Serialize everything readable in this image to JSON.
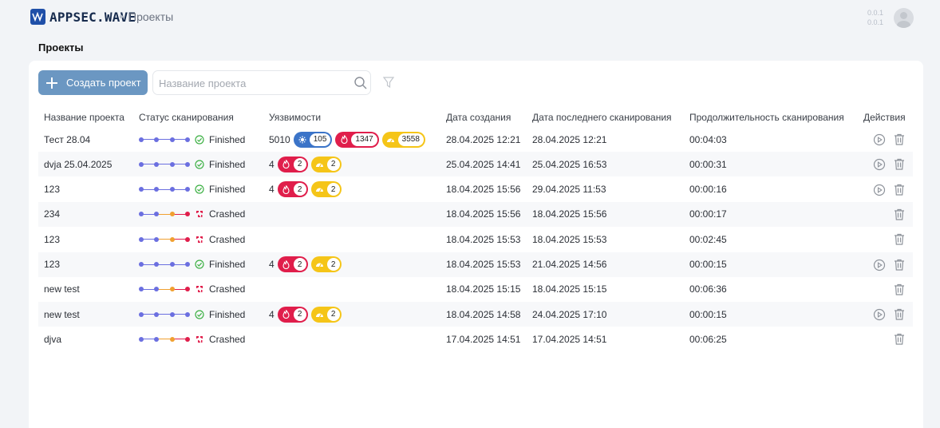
{
  "header": {
    "logo_text": "APPSEC.WAVE",
    "breadcrumb": "Проекты",
    "version_line1": "0.0.1",
    "version_line2": "0.0.1"
  },
  "page": {
    "title": "Проекты"
  },
  "toolbar": {
    "create_label": "Создать проект",
    "search_placeholder": "Название проекта"
  },
  "table": {
    "columns": {
      "name": "Название проекта",
      "status": "Статус сканирования",
      "vulns": "Уязвимости",
      "created": "Дата создания",
      "last_scan": "Дата последнего сканирования",
      "duration": "Продолжительность сканирования",
      "actions": "Действия"
    },
    "rows": [
      {
        "name": "Тест 28.04",
        "status": "Finished",
        "total": "5010",
        "low": "105",
        "high": "1347",
        "medium": "3558",
        "created": "28.04.2025 12:21",
        "last": "28.04.2025 12:21",
        "duration": "00:04:03"
      },
      {
        "name": "dvja 25.04.2025",
        "status": "Finished",
        "total": "4",
        "high": "2",
        "medium": "2",
        "created": "25.04.2025 14:41",
        "last": "25.04.2025 16:53",
        "duration": "00:00:31"
      },
      {
        "name": "123",
        "status": "Finished",
        "total": "4",
        "high": "2",
        "medium": "2",
        "created": "18.04.2025 15:56",
        "last": "29.04.2025 11:53",
        "duration": "00:00:16"
      },
      {
        "name": "234",
        "status": "Crashed",
        "created": "18.04.2025 15:56",
        "last": "18.04.2025 15:56",
        "duration": "00:00:17"
      },
      {
        "name": "123",
        "status": "Crashed",
        "created": "18.04.2025 15:53",
        "last": "18.04.2025 15:53",
        "duration": "00:02:45"
      },
      {
        "name": "123",
        "status": "Finished",
        "total": "4",
        "high": "2",
        "medium": "2",
        "created": "18.04.2025 15:53",
        "last": "21.04.2025 14:56",
        "duration": "00:00:15"
      },
      {
        "name": "new test",
        "status": "Crashed",
        "created": "18.04.2025 15:15",
        "last": "18.04.2025 15:15",
        "duration": "00:06:36"
      },
      {
        "name": "new test",
        "status": "Finished",
        "total": "4",
        "high": "2",
        "medium": "2",
        "created": "18.04.2025 14:58",
        "last": "24.04.2025 17:10",
        "duration": "00:00:15"
      },
      {
        "name": "djva",
        "status": "Crashed",
        "created": "17.04.2025 14:51",
        "last": "17.04.2025 14:51",
        "duration": "00:06:25"
      }
    ]
  },
  "colors": {
    "accent_button": "#6b97c2",
    "progress_blue": "#6b6fe0",
    "progress_orange": "#f0a030",
    "progress_red": "#e01e4b",
    "finished_green": "#3cb043",
    "crashed_red": "#e01e4b",
    "badge_blue": "#3b74c8",
    "badge_red": "#e01e4b",
    "badge_yellow": "#f5c518"
  },
  "icons": {
    "logo": "wave-logo-icon",
    "search": "search-icon",
    "filter": "filter-icon",
    "play": "play-circle-icon",
    "trash": "trash-icon",
    "finished": "check-circle-icon",
    "crashed": "crash-icon"
  }
}
